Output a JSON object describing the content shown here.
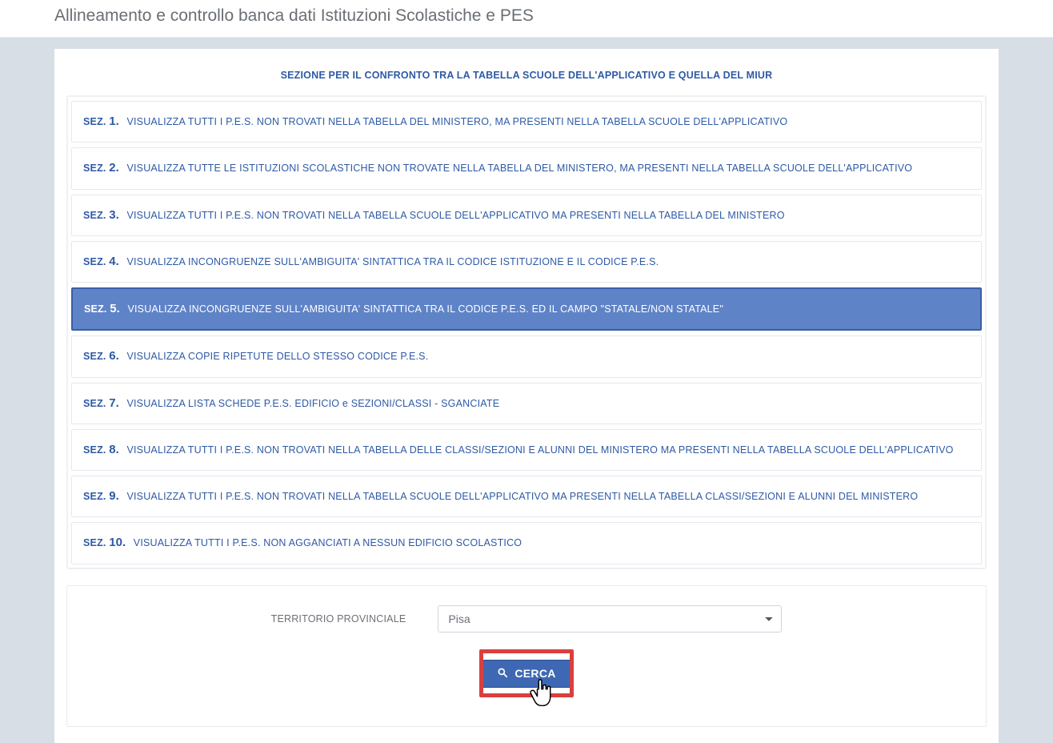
{
  "page_title": "Allineamento e controllo banca dati Istituzioni Scolastiche e PES",
  "panel_title": "SEZIONE PER IL CONFRONTO TRA LA TABELLA SCUOLE DELL'APPLICATIVO E QUELLA DEL MIUR",
  "sez_prefix": "SEZ.",
  "sections": [
    {
      "num": "1.",
      "desc": "VISUALIZZA TUTTI I P.E.S. NON TROVATI NELLA TABELLA DEL MINISTERO, MA PRESENTI NELLA TABELLA SCUOLE DELL'APPLICATIVO",
      "active": false
    },
    {
      "num": "2.",
      "desc": "VISUALIZZA TUTTE LE ISTITUZIONI SCOLASTICHE NON TROVATE NELLA TABELLA DEL MINISTERO, MA PRESENTI NELLA TABELLA SCUOLE DELL'APPLICATIVO",
      "active": false
    },
    {
      "num": "3.",
      "desc": "VISUALIZZA TUTTI I P.E.S. NON TROVATI NELLA TABELLA SCUOLE DELL'APPLICATIVO MA PRESENTI NELLA TABELLA DEL MINISTERO",
      "active": false
    },
    {
      "num": "4.",
      "desc": "VISUALIZZA INCONGRUENZE SULL'AMBIGUITA' SINTATTICA TRA IL CODICE ISTITUZIONE E IL CODICE P.E.S.",
      "active": false
    },
    {
      "num": "5.",
      "desc": "VISUALIZZA INCONGRUENZE SULL'AMBIGUITA' SINTATTICA TRA IL CODICE P.E.S. ED IL CAMPO \"STATALE/NON STATALE\"",
      "active": true
    },
    {
      "num": "6.",
      "desc": "VISUALIZZA COPIE RIPETUTE DELLO STESSO CODICE P.E.S.",
      "active": false
    },
    {
      "num": "7.",
      "desc": "VISUALIZZA LISTA SCHEDE P.E.S. EDIFICIO e SEZIONI/CLASSI - SGANCIATE",
      "active": false
    },
    {
      "num": "8.",
      "desc": "VISUALIZZA TUTTI I P.E.S. NON TROVATI NELLA TABELLA DELLE CLASSI/SEZIONI E ALUNNI DEL MINISTERO MA PRESENTI NELLA TABELLA SCUOLE DELL'APPLICATIVO",
      "active": false
    },
    {
      "num": "9.",
      "desc": "VISUALIZZA TUTTI I P.E.S. NON TROVATI NELLA TABELLA SCUOLE DELL'APPLICATIVO MA PRESENTI NELLA TABELLA CLASSI/SEZIONI E ALUNNI DEL MINISTERO",
      "active": false
    },
    {
      "num": "10.",
      "desc": "VISUALIZZA TUTTI I P.E.S. NON AGGANCIATI A NESSUN EDIFICIO SCOLASTICO",
      "active": false
    }
  ],
  "filter": {
    "label": "TERRITORIO PROVINCIALE",
    "selected": "Pisa"
  },
  "search_button_label": "CERCA"
}
